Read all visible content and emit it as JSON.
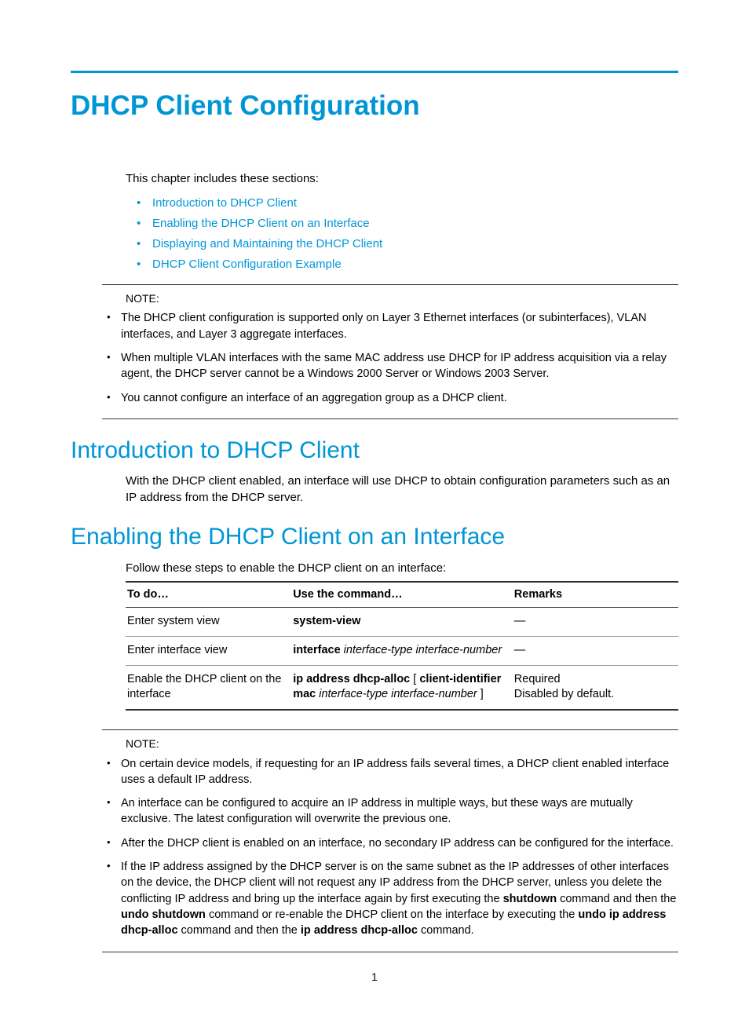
{
  "title": "DHCP Client Configuration",
  "intro": "This chapter includes these sections:",
  "toc": [
    "Introduction to DHCP Client",
    "Enabling the DHCP Client on an Interface",
    "Displaying and Maintaining the DHCP Client",
    "DHCP Client Configuration Example"
  ],
  "note1": {
    "label": "NOTE:",
    "items": [
      "The DHCP client configuration is supported only on Layer 3 Ethernet interfaces (or subinterfaces), VLAN interfaces, and Layer 3 aggregate interfaces.",
      "When multiple VLAN interfaces with the same MAC address use DHCP for IP address acquisition via a relay agent, the DHCP server cannot be a Windows 2000 Server or Windows 2003 Server.",
      "You cannot configure an interface of an aggregation group as a DHCP client."
    ]
  },
  "section_intro": {
    "heading": "Introduction to DHCP Client",
    "body": "With the DHCP client enabled, an interface will use DHCP to obtain configuration parameters such as an IP address from the DHCP server."
  },
  "section_enable": {
    "heading": "Enabling the DHCP Client on an Interface",
    "lead": "Follow these steps to enable the DHCP client on an interface:",
    "table": {
      "headers": [
        "To do…",
        "Use the command…",
        "Remarks"
      ],
      "rows": [
        {
          "todo": "Enter system view",
          "cmd_bold": "system-view",
          "cmd_ital": "",
          "remarks": "—"
        },
        {
          "todo": "Enter interface view",
          "cmd_bold": "interface",
          "cmd_ital": " interface-type interface-number",
          "remarks": "—"
        },
        {
          "todo": "Enable the DHCP client on the interface",
          "cmd_bold_a": "ip address dhcp-alloc",
          "cmd_plain_a": " [ ",
          "cmd_bold_b": "client-identifier mac",
          "cmd_ital_b": " interface-type interface-number",
          "cmd_plain_b": " ]",
          "remarks_line1": "Required",
          "remarks_line2": "Disabled by default."
        }
      ]
    }
  },
  "note2": {
    "label": "NOTE:",
    "items_plain": [
      "On certain device models, if requesting for an IP address fails several times, a DHCP client enabled interface uses a default IP address.",
      "An interface can be configured to acquire an IP address in multiple ways, but these ways are mutually exclusive. The latest configuration will overwrite the previous one.",
      "After the DHCP client is enabled on an interface, no secondary IP address can be configured for the interface."
    ],
    "item4": {
      "p1": "If the IP address assigned by the DHCP server is on the same subnet as the IP addresses of other interfaces on the device, the DHCP client will not request any IP address from the DHCP server, unless you delete the conflicting IP address and bring up the interface again by first executing the ",
      "b1": "shutdown",
      "p2": " command and then the ",
      "b2": "undo shutdown",
      "p3": " command or re-enable the DHCP client on the interface by executing the ",
      "b3": "undo ip address dhcp-alloc",
      "p4": " command and then the ",
      "b4": "ip address dhcp-alloc",
      "p5": " command."
    }
  },
  "page_number": "1"
}
